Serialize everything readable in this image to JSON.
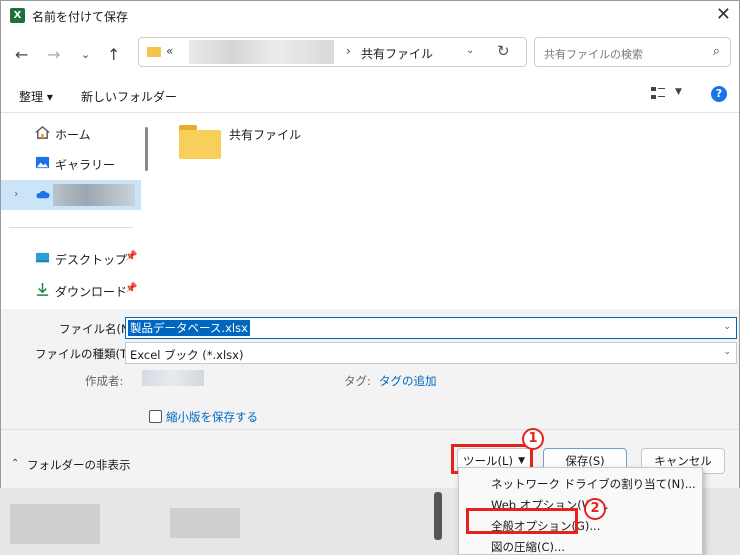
{
  "window": {
    "title": "名前を付けて保存",
    "app_icon": "X"
  },
  "nav": {
    "address_prefix": "«",
    "address_current": "共有ファイル",
    "search_placeholder": "共有ファイルの検索"
  },
  "toolbar": {
    "organize": "整理 ▾",
    "new_folder": "新しいフォルダー"
  },
  "sidebar": {
    "items": [
      {
        "label": "ホーム",
        "icon": "home-icon"
      },
      {
        "label": "ギャラリー",
        "icon": "gallery-icon"
      },
      {
        "label": "",
        "icon": "onedrive-icon"
      },
      {
        "label": "デスクトップ",
        "icon": "desktop-icon"
      },
      {
        "label": "ダウンロード",
        "icon": "download-icon"
      }
    ]
  },
  "content": {
    "folder_name": "共有ファイル"
  },
  "form": {
    "filename_label": "ファイル名(N):",
    "filename_value": "製品データベース.xlsx",
    "filetype_label": "ファイルの種類(T):",
    "filetype_value": "Excel ブック (*.xlsx)",
    "author_label": "作成者:",
    "tags_label": "タグ:",
    "tags_link": "タグの追加",
    "thumbnail_label": "縮小版を保存する"
  },
  "bottom": {
    "hide_folders": "フォルダーの非表示",
    "tools": "ツール(L)",
    "save": "保存(S)",
    "cancel": "キャンセル"
  },
  "menu": {
    "items": [
      "ネットワーク ドライブの割り当て(N)...",
      "Web オプション(W)...",
      "全般オプション(G)...",
      "図の圧縮(C)..."
    ]
  },
  "annotations": {
    "badge1": "1",
    "badge2": "2",
    "highlight_color": "#e5231e"
  }
}
